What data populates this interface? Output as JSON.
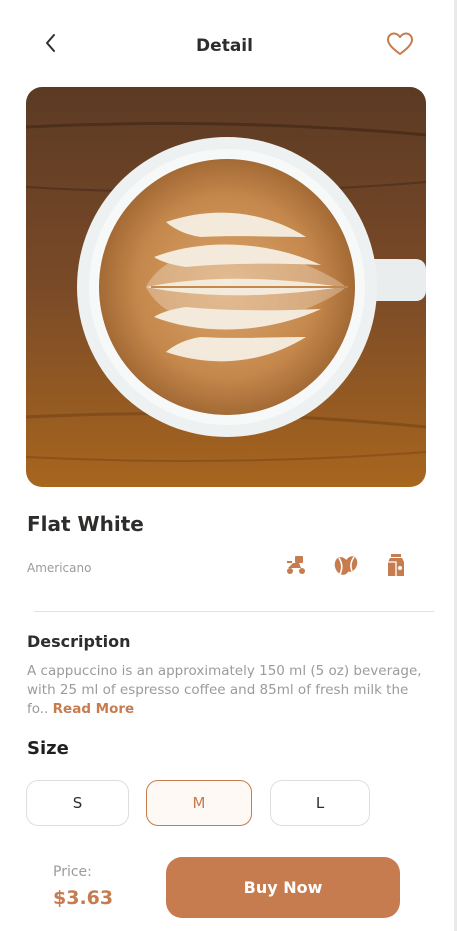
{
  "header": {
    "title": "Detail",
    "back_icon": "chevron-left-icon",
    "favorite_icon": "heart-outline-icon"
  },
  "product": {
    "name": "Flat White",
    "subtitle": "Americano",
    "image_alt": "latte-art-coffee-cup",
    "features": [
      {
        "icon": "delivery-scooter-icon"
      },
      {
        "icon": "coffee-bean-icon"
      },
      {
        "icon": "milk-carton-icon"
      }
    ]
  },
  "description": {
    "heading": "Description",
    "text": "A cappuccino is an approximately 150 ml (5 oz) beverage, with 25 ml of espresso coffee and 85ml of fresh milk the fo.. ",
    "read_more": "Read More"
  },
  "size": {
    "heading": "Size",
    "options": [
      "S",
      "M",
      "L"
    ],
    "selected": "M"
  },
  "footer": {
    "price_label": "Price:",
    "price_value": "$3.63",
    "buy_label": "Buy Now"
  },
  "colors": {
    "accent": "#C67C4E",
    "text_primary": "#2F2D2C",
    "text_secondary": "#9B9B9B"
  }
}
